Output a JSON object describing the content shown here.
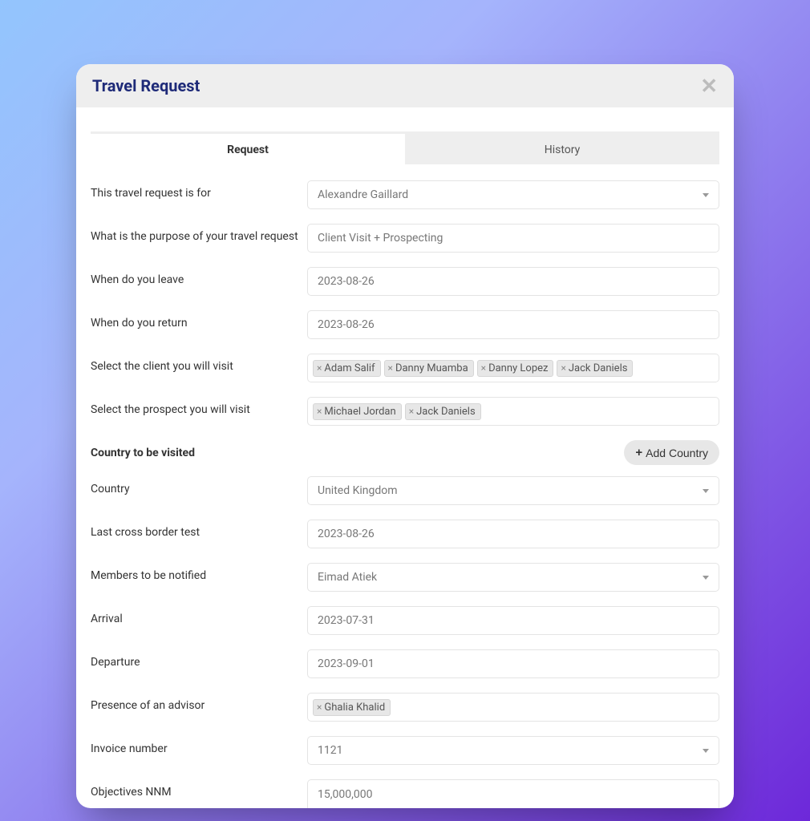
{
  "modal": {
    "title": "Travel Request"
  },
  "tabs": {
    "request": "Request",
    "history": "History"
  },
  "labels": {
    "for": "This travel request is for",
    "purpose": "What is the purpose of your travel request",
    "leave": "When do you leave",
    "return": "When do you return",
    "client": "Select the client you will visit",
    "prospect": "Select the prospect you will visit",
    "country_section": "Country to be visited",
    "add_country": "Add Country",
    "country": "Country",
    "last_cross": "Last cross border test",
    "notify": "Members to be notified",
    "arrival": "Arrival",
    "departure": "Departure",
    "advisor": "Presence of an advisor",
    "invoice": "Invoice number",
    "objectives": "Objectives NNM"
  },
  "values": {
    "for": "Alexandre Gaillard",
    "purpose": "Client Visit + Prospecting",
    "leave": "2023-08-26",
    "return": "2023-08-26",
    "country": "United Kingdom",
    "last_cross": "2023-08-26",
    "notify": "Eimad Atiek",
    "arrival": "2023-07-31",
    "departure": "2023-09-01",
    "invoice": "1121",
    "objectives": "15,000,000"
  },
  "client_tags": [
    "Adam Salif",
    "Danny Muamba",
    "Danny Lopez",
    "Jack Daniels"
  ],
  "prospect_tags": [
    "Michael Jordan",
    "Jack Daniels"
  ],
  "advisor_tags": [
    "Ghalia Khalid"
  ]
}
